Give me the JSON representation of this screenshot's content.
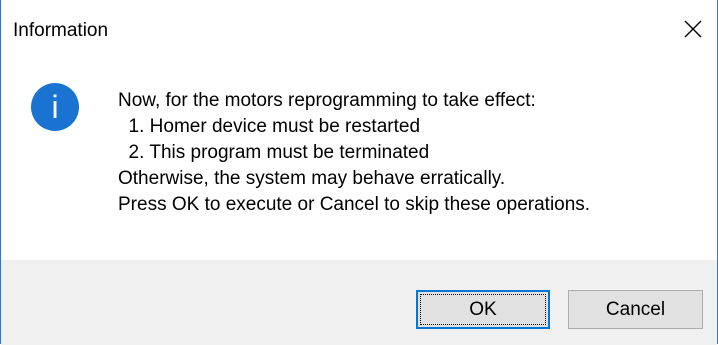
{
  "window": {
    "title": "Information",
    "close_icon": "close-icon"
  },
  "icon": {
    "name": "info-icon",
    "glyph": "i",
    "color": "#1a73d1"
  },
  "message": {
    "lines": [
      "Now, for the motors reprogramming to take effect:",
      "  1. Homer device must be restarted",
      "  2. This program must be terminated",
      "Otherwise, the system may behave erratically.",
      "Press OK to execute or Cancel to skip these operations."
    ]
  },
  "buttons": {
    "ok_label": "OK",
    "cancel_label": "Cancel"
  },
  "colors": {
    "accent": "#0078d7",
    "footer_bg": "#f0f0f0",
    "window_border": "#2b78c4"
  }
}
